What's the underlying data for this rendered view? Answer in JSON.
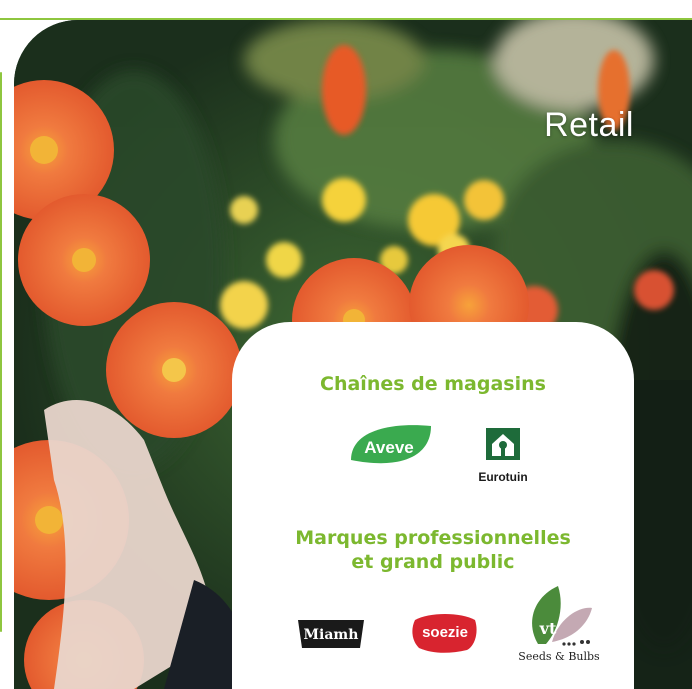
{
  "photo": {
    "title": "Retail",
    "description_icon": "orange-gerbera-flowers-photo"
  },
  "card": {
    "stores_heading": "Chaînes de magasins",
    "brands_heading": "Marques professionnelles et grand public",
    "store_logos": [
      {
        "name": "aveve-logo",
        "text": "Aveve"
      },
      {
        "name": "eurotuin-logo",
        "text": "Eurotuin"
      }
    ],
    "brand_logos": [
      {
        "name": "miamh-logo",
        "text": "Miamh"
      },
      {
        "name": "soezie-logo",
        "text": "soezie"
      },
      {
        "name": "seeds-bulbs-logo",
        "text": "Seeds & Bulbs",
        "mark": "vt"
      }
    ]
  },
  "colors": {
    "accent_green": "#8ec63f",
    "heading_green": "#7cb82f",
    "flower_orange": "#ee6a3a",
    "aveve_green": "#3aaa4f",
    "soezie_red": "#d8242f"
  }
}
